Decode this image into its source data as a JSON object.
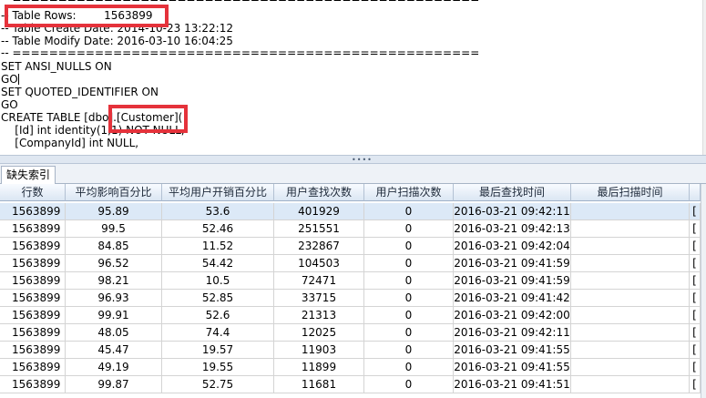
{
  "editor": {
    "lines": [
      "-- ===================================================",
      "-- Table Rows:        1563899",
      "-- Table Create Date: 2014-10-23 13:22:12",
      "-- Table Modify Date: 2016-03-10 16:04:25",
      "-- ===================================================",
      "",
      "SET ANSI_NULLS ON",
      "GO",
      "SET QUOTED_IDENTIFIER ON",
      "GO",
      "CREATE TABLE [dbo].[Customer](",
      "    [Id] int identity(1,1) NOT NULL,",
      "    [CompanyId] int NULL,"
    ]
  },
  "tab": {
    "label": "缺失索引"
  },
  "grid": {
    "columns": [
      "行数",
      "平均影响百分比",
      "平均用户开销百分比",
      "用户查找次数",
      "用户扫描次数",
      "最后查找时间",
      "最后扫描时间",
      ""
    ],
    "rows": [
      [
        "1563899",
        "95.89",
        "53.6",
        "401929",
        "0",
        "2016-03-21 09:42:11",
        "",
        "["
      ],
      [
        "1563899",
        "99.5",
        "52.46",
        "251551",
        "0",
        "2016-03-21 09:42:13",
        "",
        "["
      ],
      [
        "1563899",
        "84.85",
        "11.52",
        "232867",
        "0",
        "2016-03-21 09:42:04",
        "",
        "["
      ],
      [
        "1563899",
        "96.52",
        "54.42",
        "104503",
        "0",
        "2016-03-21 09:41:59",
        "",
        "["
      ],
      [
        "1563899",
        "98.21",
        "10.5",
        "72471",
        "0",
        "2016-03-21 09:41:59",
        "",
        "["
      ],
      [
        "1563899",
        "96.93",
        "52.85",
        "33715",
        "0",
        "2016-03-21 09:41:42",
        "",
        "["
      ],
      [
        "1563899",
        "99.91",
        "52.6",
        "21313",
        "0",
        "2016-03-21 09:42:00",
        "",
        "["
      ],
      [
        "1563899",
        "48.05",
        "74.4",
        "12025",
        "0",
        "2016-03-21 09:42:11",
        "",
        "["
      ],
      [
        "1563899",
        "45.47",
        "19.57",
        "11903",
        "0",
        "2016-03-21 09:41:55",
        "",
        "["
      ],
      [
        "1563899",
        "49.19",
        "19.55",
        "11899",
        "0",
        "2016-03-21 09:41:55",
        "",
        "["
      ],
      [
        "1563899",
        "99.87",
        "52.75",
        "11681",
        "0",
        "2016-03-21 09:41:51",
        "",
        "["
      ]
    ]
  },
  "colors": {
    "highlight": "#e5323b",
    "selected_row": "#dce9f7"
  }
}
